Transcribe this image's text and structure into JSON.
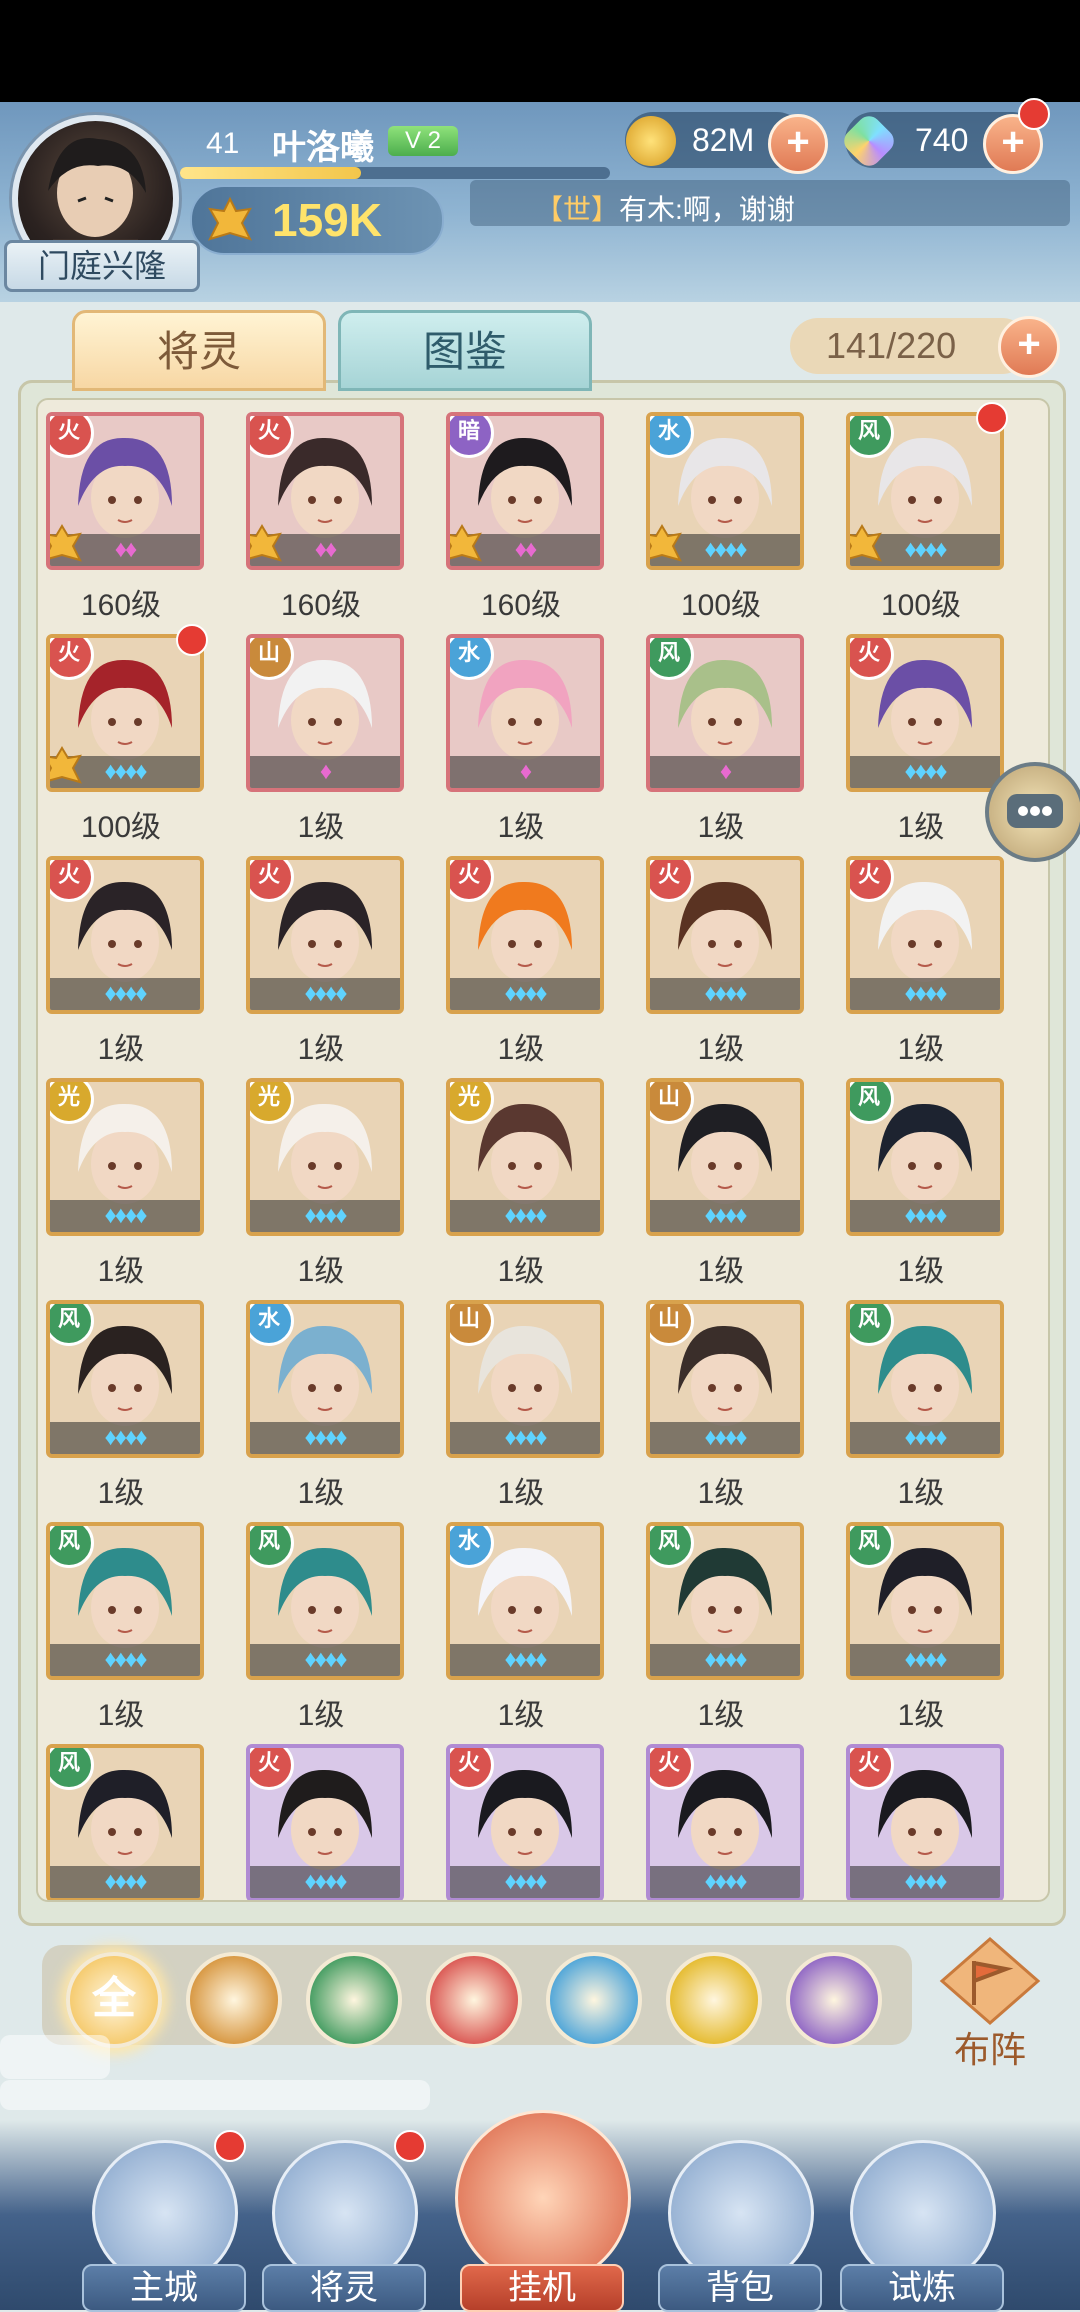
{
  "player": {
    "level": "41",
    "name": "叶洛曦",
    "vip": "V 2",
    "power": "159K",
    "clan": "门庭兴隆",
    "exp_fraction": 0.42
  },
  "resources": {
    "coins": "82M",
    "gems": "740"
  },
  "chat": {
    "channel": "【世】",
    "message": "有木:啊，谢谢"
  },
  "tabs": {
    "active": "将灵",
    "inactive": "图鉴"
  },
  "roster_count": "141/220",
  "cards": [
    {
      "level": "160级",
      "element": "fire",
      "frame": "red",
      "crown": true,
      "stars": 2,
      "dot": false
    },
    {
      "level": "160级",
      "element": "fire",
      "frame": "red",
      "crown": true,
      "stars": 2,
      "dot": false
    },
    {
      "level": "160级",
      "element": "shadow",
      "frame": "red",
      "crown": true,
      "stars": 2,
      "dot": false
    },
    {
      "level": "100级",
      "element": "water",
      "frame": "gold",
      "crown": true,
      "stars": 4,
      "dot": false
    },
    {
      "level": "100级",
      "element": "wind",
      "frame": "gold",
      "crown": true,
      "stars": 4,
      "dot": true
    },
    {
      "level": "100级",
      "element": "fire",
      "frame": "gold",
      "crown": true,
      "stars": 4,
      "dot": true
    },
    {
      "level": "1级",
      "element": "earth",
      "frame": "red",
      "crown": false,
      "stars": 1,
      "dot": false
    },
    {
      "level": "1级",
      "element": "water",
      "frame": "red",
      "crown": false,
      "stars": 1,
      "dot": false
    },
    {
      "level": "1级",
      "element": "wind",
      "frame": "red",
      "crown": false,
      "stars": 1,
      "dot": false
    },
    {
      "level": "1级",
      "element": "fire",
      "frame": "gold",
      "crown": false,
      "stars": 4,
      "dot": false
    },
    {
      "level": "1级",
      "element": "fire",
      "frame": "gold",
      "crown": false,
      "stars": 4,
      "dot": false
    },
    {
      "level": "1级",
      "element": "fire",
      "frame": "gold",
      "crown": false,
      "stars": 4,
      "dot": false
    },
    {
      "level": "1级",
      "element": "fire",
      "frame": "gold",
      "crown": false,
      "stars": 4,
      "dot": false
    },
    {
      "level": "1级",
      "element": "fire",
      "frame": "gold",
      "crown": false,
      "stars": 4,
      "dot": false
    },
    {
      "level": "1级",
      "element": "fire",
      "frame": "gold",
      "crown": false,
      "stars": 4,
      "dot": false
    },
    {
      "level": "1级",
      "element": "light",
      "frame": "gold",
      "crown": false,
      "stars": 4,
      "dot": false
    },
    {
      "level": "1级",
      "element": "light",
      "frame": "gold",
      "crown": false,
      "stars": 4,
      "dot": false
    },
    {
      "level": "1级",
      "element": "light",
      "frame": "gold",
      "crown": false,
      "stars": 4,
      "dot": false
    },
    {
      "level": "1级",
      "element": "earth",
      "frame": "gold",
      "crown": false,
      "stars": 4,
      "dot": false
    },
    {
      "level": "1级",
      "element": "wind",
      "frame": "gold",
      "crown": false,
      "stars": 4,
      "dot": false
    },
    {
      "level": "1级",
      "element": "wind",
      "frame": "gold",
      "crown": false,
      "stars": 4,
      "dot": false
    },
    {
      "level": "1级",
      "element": "water",
      "frame": "gold",
      "crown": false,
      "stars": 4,
      "dot": false
    },
    {
      "level": "1级",
      "element": "earth",
      "frame": "gold",
      "crown": false,
      "stars": 4,
      "dot": false
    },
    {
      "level": "1级",
      "element": "earth",
      "frame": "gold",
      "crown": false,
      "stars": 4,
      "dot": false
    },
    {
      "level": "1级",
      "element": "wind",
      "frame": "gold",
      "crown": false,
      "stars": 4,
      "dot": false
    },
    {
      "level": "1级",
      "element": "wind",
      "frame": "gold",
      "crown": false,
      "stars": 4,
      "dot": false
    },
    {
      "level": "1级",
      "element": "wind",
      "frame": "gold",
      "crown": false,
      "stars": 4,
      "dot": false
    },
    {
      "level": "1级",
      "element": "water",
      "frame": "gold",
      "crown": false,
      "stars": 4,
      "dot": false
    },
    {
      "level": "1级",
      "element": "wind",
      "frame": "gold",
      "crown": false,
      "stars": 4,
      "dot": false
    },
    {
      "level": "1级",
      "element": "wind",
      "frame": "gold",
      "crown": false,
      "stars": 4,
      "dot": false
    },
    {
      "level": "",
      "element": "wind",
      "frame": "gold",
      "crown": false,
      "stars": 4,
      "dot": false
    },
    {
      "level": "",
      "element": "fire",
      "frame": "purple",
      "crown": false,
      "stars": 4,
      "dot": false
    },
    {
      "level": "",
      "element": "fire",
      "frame": "purple",
      "crown": false,
      "stars": 4,
      "dot": false
    },
    {
      "level": "",
      "element": "fire",
      "frame": "purple",
      "crown": false,
      "stars": 4,
      "dot": false
    },
    {
      "level": "",
      "element": "fire",
      "frame": "purple",
      "crown": false,
      "stars": 4,
      "dot": false
    }
  ],
  "element_colors": {
    "fire": "#d9534f",
    "water": "#4aa3d8",
    "wind": "#3f9a5e",
    "earth": "#c98a3b",
    "light": "#d8a92d",
    "shadow": "#8d63c4"
  },
  "filters": [
    {
      "name": "all",
      "label": "全",
      "color": "#f5c96a"
    },
    {
      "name": "earth",
      "label": "",
      "color": "#d6943c"
    },
    {
      "name": "wind",
      "label": "",
      "color": "#3f9a5e"
    },
    {
      "name": "fire",
      "label": "",
      "color": "#d9534f"
    },
    {
      "name": "water",
      "label": "",
      "color": "#4aa3d8"
    },
    {
      "name": "light",
      "label": "",
      "color": "#e4b92a"
    },
    {
      "name": "shadow",
      "label": "",
      "color": "#8d63c4"
    }
  ],
  "formation_label": "布阵",
  "nav": [
    {
      "label": "主城",
      "dot": true
    },
    {
      "label": "将灵",
      "dot": true
    },
    {
      "label": "挂机",
      "dot": false
    },
    {
      "label": "背包",
      "dot": false
    },
    {
      "label": "试炼",
      "dot": false
    }
  ]
}
